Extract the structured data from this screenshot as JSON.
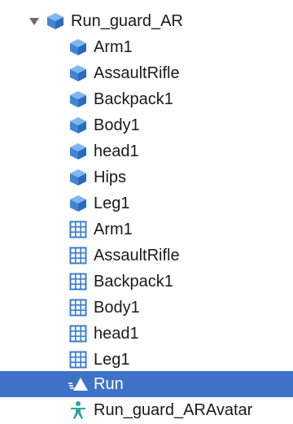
{
  "hierarchy": {
    "root": {
      "label": "Run_guard_AR",
      "icon": "prefab-icon",
      "expanded": true
    },
    "children": [
      {
        "label": "Arm1",
        "icon": "prefab-icon"
      },
      {
        "label": "AssaultRifle",
        "icon": "prefab-icon"
      },
      {
        "label": "Backpack1",
        "icon": "prefab-icon"
      },
      {
        "label": "Body1",
        "icon": "prefab-icon"
      },
      {
        "label": "head1",
        "icon": "prefab-icon"
      },
      {
        "label": "Hips",
        "icon": "prefab-icon"
      },
      {
        "label": "Leg1",
        "icon": "prefab-icon"
      },
      {
        "label": "Arm1",
        "icon": "mesh-grid-icon"
      },
      {
        "label": "AssaultRifle",
        "icon": "mesh-grid-icon"
      },
      {
        "label": "Backpack1",
        "icon": "mesh-grid-icon"
      },
      {
        "label": "Body1",
        "icon": "mesh-grid-icon"
      },
      {
        "label": "head1",
        "icon": "mesh-grid-icon"
      },
      {
        "label": "Leg1",
        "icon": "mesh-grid-icon"
      },
      {
        "label": "Run",
        "icon": "animation-clip-icon",
        "selected": true
      },
      {
        "label": "Run_guard_ARAvatar",
        "icon": "avatar-icon"
      }
    ]
  },
  "colors": {
    "selection": "#3d72c8",
    "prefab_blue": "#4a90d9",
    "mesh_blue": "#3a7bd5",
    "avatar_teal": "#2aa8a0"
  }
}
